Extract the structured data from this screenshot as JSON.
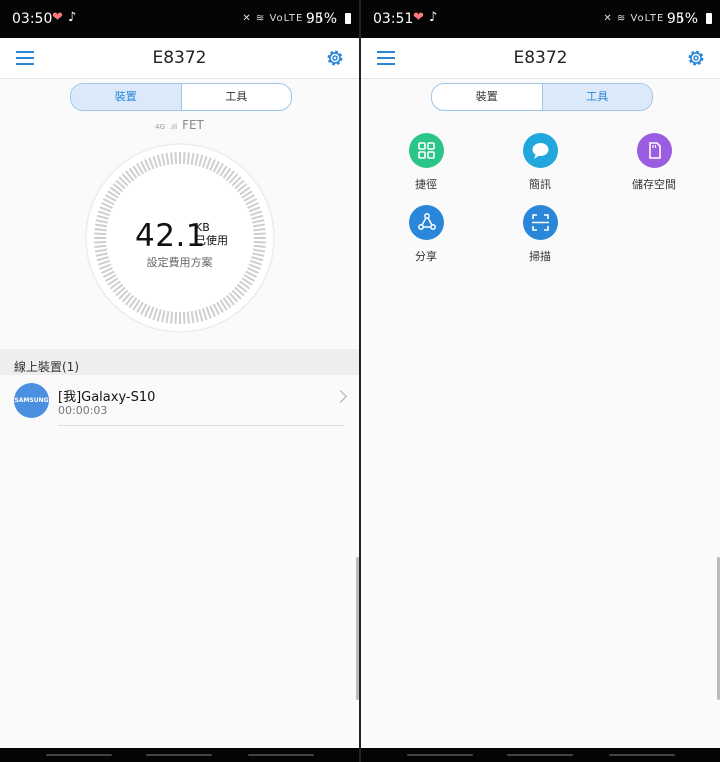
{
  "left": {
    "status": {
      "time": "03:50",
      "battery": "95%",
      "icons": "✕ ≋ VoLTE .ıll"
    },
    "title": "E8372",
    "tabs": [
      "裝置",
      "工具"
    ],
    "network": {
      "signal": "4G",
      "carrier": "FET"
    },
    "usage": {
      "value": "42.1",
      "unit": "KB",
      "used_label": "已使用",
      "plan_link": "設定費用方案"
    },
    "devices_header": "線上裝置(1)",
    "devices": [
      {
        "avatar_text": "SAMSUNG",
        "name": "[我]Galaxy-S10",
        "duration": "00:00:03"
      }
    ]
  },
  "right": {
    "status": {
      "time": "03:51",
      "battery": "95%",
      "icons": "✕ ≋ VoLTE .ıll"
    },
    "title": "E8372",
    "tabs": [
      "裝置",
      "工具"
    ],
    "tools": [
      {
        "label": "捷徑",
        "icon": "shortcut-grid-icon",
        "color": "#2bc58a"
      },
      {
        "label": "簡訊",
        "icon": "sms-bubble-icon",
        "color": "#1fa7de"
      },
      {
        "label": "儲存空間",
        "icon": "sd-card-icon",
        "color": "#9a5ce0"
      },
      {
        "label": "分享",
        "icon": "share-icon",
        "color": "#2a86d9"
      },
      {
        "label": "掃描",
        "icon": "scan-icon",
        "color": "#2a86d9"
      }
    ]
  },
  "colors": {
    "accent": "#2a86d9",
    "tab_active_bg": "#dbe9fa"
  }
}
